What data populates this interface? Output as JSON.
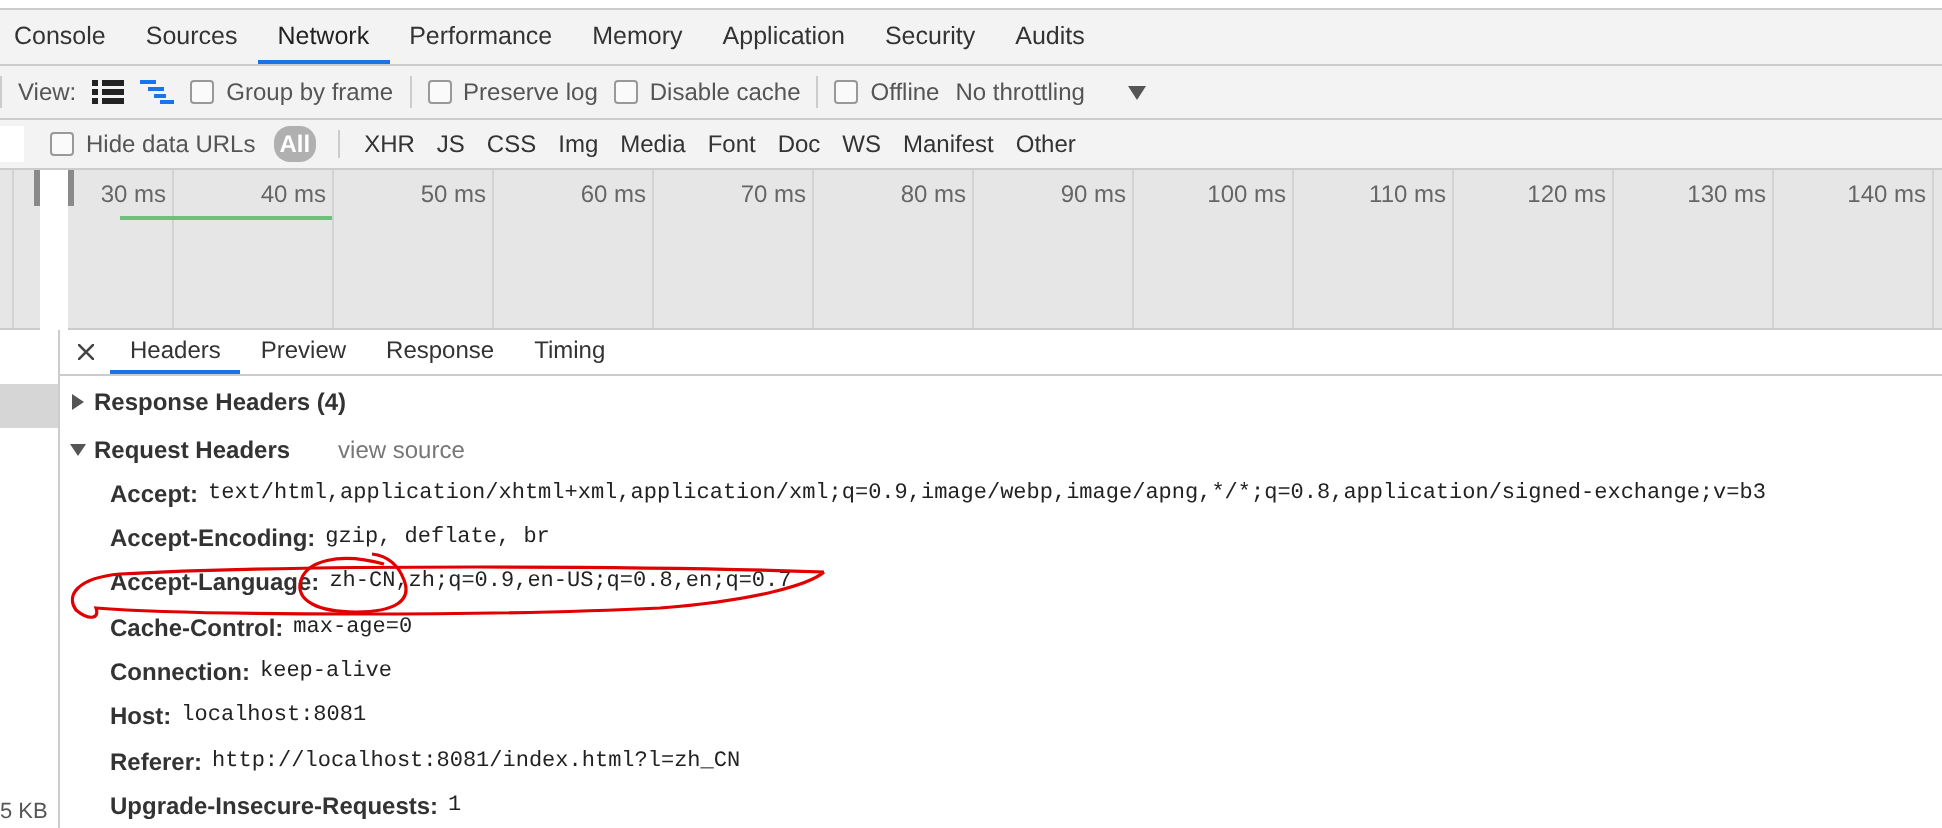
{
  "tabs": [
    {
      "label": "Console",
      "selected": false
    },
    {
      "label": "Sources",
      "selected": false
    },
    {
      "label": "Network",
      "selected": true
    },
    {
      "label": "Performance",
      "selected": false
    },
    {
      "label": "Memory",
      "selected": false
    },
    {
      "label": "Application",
      "selected": false
    },
    {
      "label": "Security",
      "selected": false
    },
    {
      "label": "Audits",
      "selected": false
    }
  ],
  "toolbar": {
    "view_label": "View:",
    "views": [
      {
        "kind": "list",
        "selected": false
      },
      {
        "kind": "waterfall",
        "selected": true
      }
    ],
    "options": [
      {
        "label": "Group by frame",
        "checked": false
      },
      {
        "label": "Preserve log",
        "checked": false
      },
      {
        "label": "Disable cache",
        "checked": false
      },
      {
        "label": "Offline",
        "checked": false
      }
    ],
    "throttling": "No throttling"
  },
  "filter_bar": {
    "hide_data_urls": {
      "label": "Hide data URLs",
      "checked": false
    },
    "types": [
      {
        "label": "All",
        "selected": true
      },
      {
        "label": "XHR",
        "selected": false
      },
      {
        "label": "JS",
        "selected": false
      },
      {
        "label": "CSS",
        "selected": false
      },
      {
        "label": "Img",
        "selected": false
      },
      {
        "label": "Media",
        "selected": false
      },
      {
        "label": "Font",
        "selected": false
      },
      {
        "label": "Doc",
        "selected": false
      },
      {
        "label": "WS",
        "selected": false
      },
      {
        "label": "Manifest",
        "selected": false
      },
      {
        "label": "Other",
        "selected": false
      }
    ]
  },
  "timeline": {
    "ticks": [
      "30 ms",
      "40 ms",
      "50 ms",
      "60 ms",
      "70 ms",
      "80 ms",
      "90 ms",
      "100 ms",
      "110 ms",
      "120 ms",
      "130 ms",
      "140 ms"
    ]
  },
  "request_list": {
    "size": "5 KB"
  },
  "details": {
    "tabs": [
      {
        "label": "Headers",
        "selected": true
      },
      {
        "label": "Preview",
        "selected": false
      },
      {
        "label": "Response",
        "selected": false
      },
      {
        "label": "Timing",
        "selected": false
      }
    ],
    "sections": [
      {
        "title": "Response Headers (4)",
        "expanded": false
      },
      {
        "title": "Request Headers",
        "expanded": true,
        "link": "view source",
        "headers": [
          {
            "name": "Accept:",
            "value": "text/html,application/xhtml+xml,application/xml;q=0.9,image/webp,image/apng,*/*;q=0.8,application/signed-exchange;v=b3"
          },
          {
            "name": "Accept-Encoding:",
            "value": "gzip, deflate, br"
          },
          {
            "name": "Accept-Language:",
            "value": "zh-CN,zh;q=0.9,en-US;q=0.8,en;q=0.7"
          },
          {
            "name": "Cache-Control:",
            "value": "max-age=0"
          },
          {
            "name": "Connection:",
            "value": "keep-alive"
          },
          {
            "name": "Host:",
            "value": "localhost:8081"
          },
          {
            "name": "Referer:",
            "value": "http://localhost:8081/index.html?l=zh_CN"
          },
          {
            "name": "Upgrade-Insecure-Requests:",
            "value": "1"
          }
        ]
      }
    ]
  }
}
